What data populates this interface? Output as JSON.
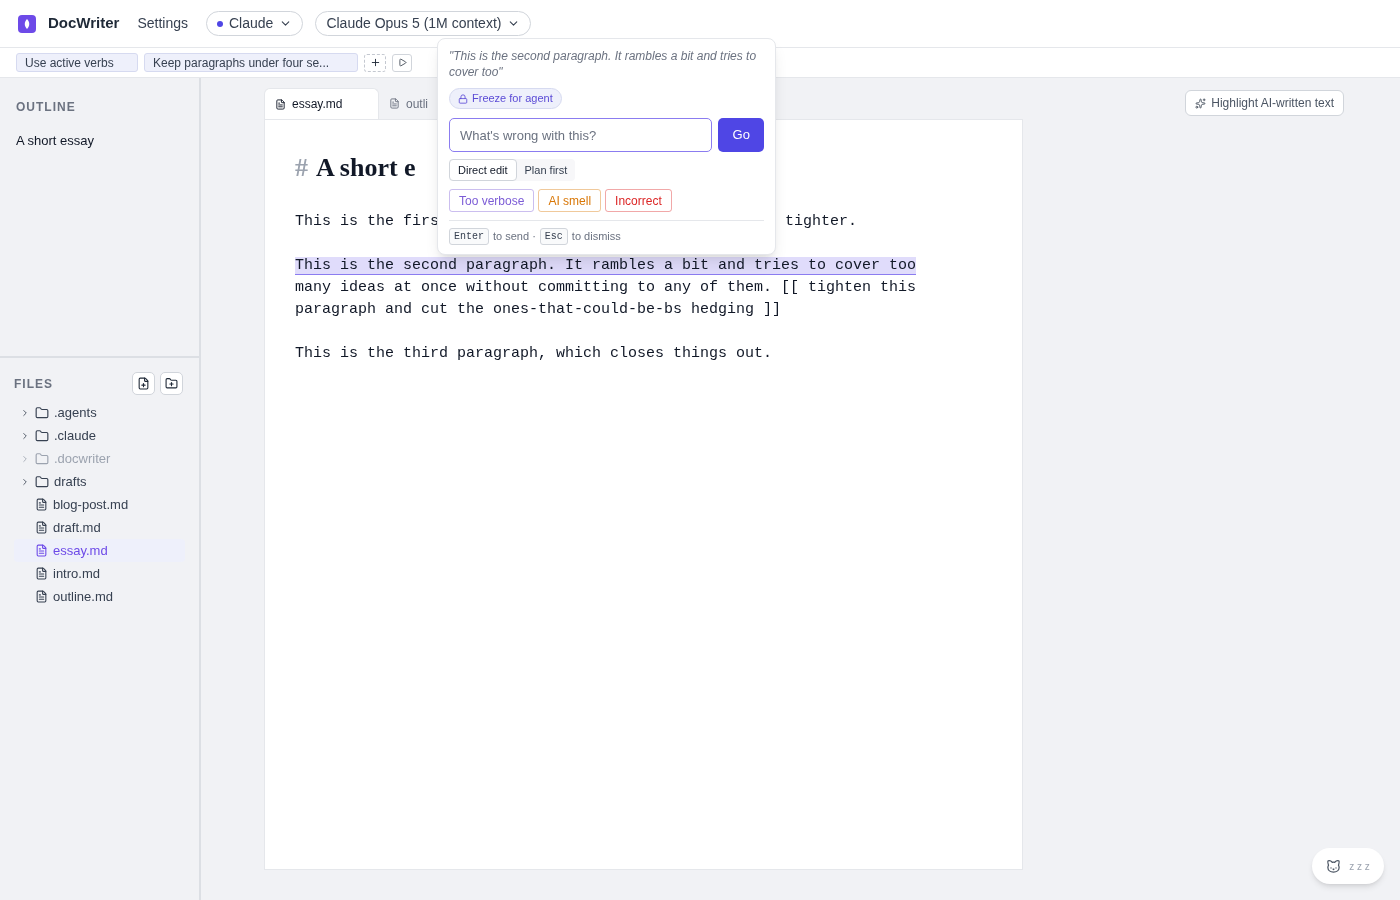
{
  "header": {
    "app_name": "DocWriter",
    "settings": "Settings",
    "provider": {
      "label": "Claude",
      "color": "#4f46e5"
    },
    "model": "Claude Opus 5 (1M context)"
  },
  "rules": [
    "Use active verbs",
    "Keep paragraphs under four se..."
  ],
  "outline": {
    "title": "OUTLINE",
    "items": [
      "A short essay"
    ]
  },
  "files": {
    "title": "FILES",
    "items": [
      {
        "kind": "folder",
        "name": ".agents",
        "dimmed": false,
        "selected": false
      },
      {
        "kind": "folder",
        "name": ".claude",
        "dimmed": false,
        "selected": false
      },
      {
        "kind": "folder",
        "name": ".docwriter",
        "dimmed": true,
        "selected": false
      },
      {
        "kind": "folder",
        "name": "drafts",
        "dimmed": false,
        "selected": false
      },
      {
        "kind": "file",
        "name": "blog-post.md",
        "dimmed": false,
        "selected": false
      },
      {
        "kind": "file",
        "name": "draft.md",
        "dimmed": false,
        "selected": false
      },
      {
        "kind": "file",
        "name": "essay.md",
        "dimmed": false,
        "selected": true
      },
      {
        "kind": "file",
        "name": "intro.md",
        "dimmed": false,
        "selected": false
      },
      {
        "kind": "file",
        "name": "outline.md",
        "dimmed": false,
        "selected": false
      }
    ]
  },
  "tabs": [
    {
      "label": "essay.md",
      "selected": true
    },
    {
      "label": "outli",
      "selected": false
    }
  ],
  "highlight_button": "Highlight AI-written text",
  "document": {
    "heading_mark": "#",
    "heading": "A short e",
    "paragraphs": [
      {
        "kind": "split",
        "start": "This is the firs",
        "end": "tighter."
      },
      {
        "kind": "highlighted",
        "highlight": "This is the second paragraph. It rambles a bit and tries to cover too",
        "rest": "many ideas at once without committing to any of them. [[ tighten this paragraph and cut the ones-that-could-be-bs hedging ]]"
      },
      {
        "kind": "plain",
        "text": "This is the third paragraph, which closes things out."
      }
    ]
  },
  "popover": {
    "quote": "\"This is the second paragraph. It rambles a bit and tries to cover too\"",
    "freeze": "Freeze for agent",
    "placeholder": "What's wrong with this?",
    "go": "Go",
    "modes": [
      {
        "label": "Direct edit",
        "selected": true
      },
      {
        "label": "Plan first",
        "selected": false
      }
    ],
    "tags": [
      {
        "label": "Too verbose",
        "color": "#7c5cd6"
      },
      {
        "label": "AI smell",
        "color": "#d97706"
      },
      {
        "label": "Incorrect",
        "color": "#dc2626"
      }
    ],
    "hint": [
      {
        "key": "Enter",
        "text": "to send ·"
      },
      {
        "key": "Esc",
        "text": "to dismiss"
      }
    ]
  },
  "sleep_label": "z z z"
}
